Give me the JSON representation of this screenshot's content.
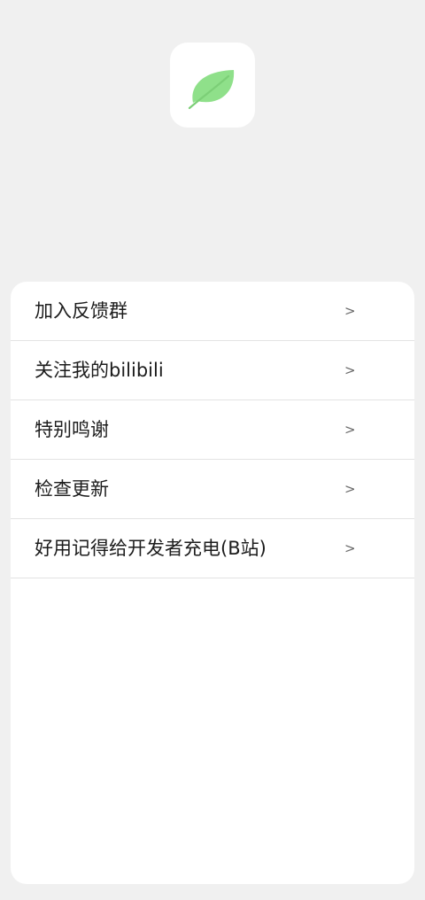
{
  "header": {
    "app_icon": "leaf-icon",
    "accent_color": "#8fe08a"
  },
  "menu": {
    "items": [
      {
        "label": "加入反馈群",
        "chevron": ">"
      },
      {
        "label": "关注我的bilibili",
        "chevron": ">"
      },
      {
        "label": "特别鸣谢",
        "chevron": ">"
      },
      {
        "label": "检查更新",
        "chevron": ">"
      },
      {
        "label": "好用记得给开发者充电(B站)",
        "chevron": ">"
      }
    ]
  }
}
